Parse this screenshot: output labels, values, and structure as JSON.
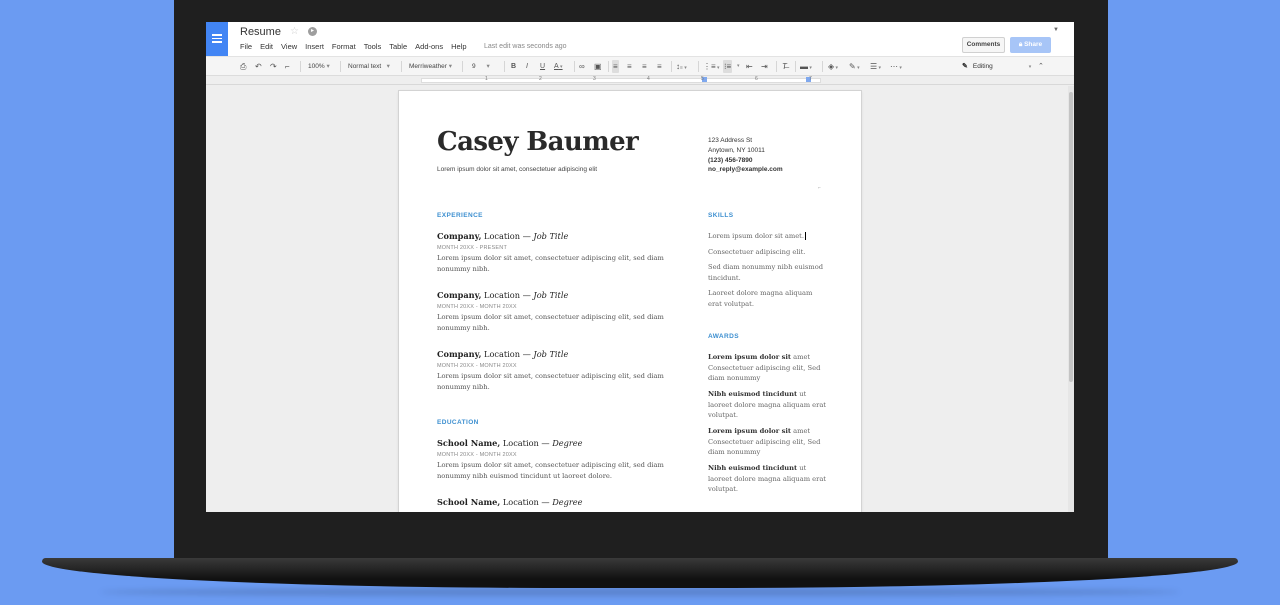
{
  "doc": {
    "title": "Resume",
    "last_edit": "Last edit was seconds ago"
  },
  "menu": [
    "File",
    "Edit",
    "View",
    "Insert",
    "Format",
    "Tools",
    "Table",
    "Add-ons",
    "Help"
  ],
  "header_buttons": {
    "comments": "Comments",
    "share": "Share"
  },
  "toolbar": {
    "zoom": "100%",
    "style": "Normal text",
    "font": "Merriweather",
    "size": "9",
    "mode": "Editing"
  },
  "ruler_numbers": [
    "1",
    "2",
    "3",
    "4",
    "5",
    "6",
    "7"
  ],
  "resume": {
    "name": "Casey Baumer",
    "tagline": "Lorem ipsum dolor sit amet, consectetuer adipiscing elit",
    "contact": {
      "address": "123 Address St",
      "city": "Anytown, NY 10011",
      "phone": "(123) 456-7890",
      "email": "no_reply@example.com"
    },
    "experience_heading": "EXPERIENCE",
    "jobs": [
      {
        "company": "Company,",
        "location": " Location — ",
        "title": "Job Title",
        "dates": "MONTH 20XX - PRESENT",
        "desc": "Lorem ipsum dolor sit amet, consectetuer adipiscing elit, sed diam nonummy nibh."
      },
      {
        "company": "Company,",
        "location": " Location — ",
        "title": "Job Title",
        "dates": "MONTH 20XX - MONTH 20XX",
        "desc": "Lorem ipsum dolor sit amet, consectetuer adipiscing elit, sed diam nonummy nibh."
      },
      {
        "company": "Company,",
        "location": " Location — ",
        "title": "Job Title",
        "dates": "MONTH 20XX - MONTH 20XX",
        "desc": "Lorem ipsum dolor sit amet, consectetuer adipiscing elit, sed diam nonummy nibh."
      }
    ],
    "education_heading": "EDUCATION",
    "schools": [
      {
        "name": "School Name,",
        "location": " Location — ",
        "degree": "Degree",
        "dates": "MONTH 20XX - MONTH 20XX",
        "desc": "Lorem ipsum dolor sit amet, consectetuer adipiscing elit, sed diam nonummy nibh euismod tincidunt ut laoreet dolore."
      },
      {
        "name": "School Name,",
        "location": " Location — ",
        "degree": "Degree"
      }
    ],
    "skills_heading": "SKILLS",
    "skills": [
      "Lorem ipsum dolor sit amet.",
      "Consectetuer adipiscing elit.",
      "Sed diam nonummy nibh euismod tincidunt.",
      "Laoreet dolore magna aliquam erat volutpat."
    ],
    "awards_heading": "AWARDS",
    "awards": [
      {
        "bold": "Lorem ipsum dolor sit",
        "rest": " amet Consectetuer adipiscing elit, Sed diam nonummy"
      },
      {
        "bold": "Nibh euismod tincidunt",
        "rest": " ut laoreet dolore magna aliquam erat volutpat."
      },
      {
        "bold": "Lorem ipsum dolor sit",
        "rest": " amet Consectetuer adipiscing elit, Sed diam nonummy"
      },
      {
        "bold": "Nibh euismod tincidunt",
        "rest": " ut laoreet dolore magna aliquam erat volutpat."
      }
    ]
  },
  "colors": {
    "background": "#6b9bf2",
    "docs_blue": "#4285f4",
    "section_heading": "#3d8fd0",
    "share_button": "#a7c5f7"
  },
  "icons": [
    "docs-logo-icon",
    "star-icon",
    "folder-icon",
    "print-icon",
    "undo-icon",
    "redo-icon",
    "paint-format-icon",
    "bold-icon",
    "italic-icon",
    "underline-icon",
    "text-color-icon",
    "link-icon",
    "comment-icon",
    "align-left-icon",
    "align-center-icon",
    "align-right-icon",
    "justify-icon",
    "line-spacing-icon",
    "numbered-list-icon",
    "bulleted-list-icon",
    "indent-decrease-icon",
    "indent-increase-icon",
    "clear-formatting-icon",
    "keyboard-icon",
    "fill-color-icon",
    "border-color-icon",
    "border-weight-icon",
    "border-dash-icon",
    "pencil-icon",
    "collapse-icon",
    "lock-icon"
  ]
}
